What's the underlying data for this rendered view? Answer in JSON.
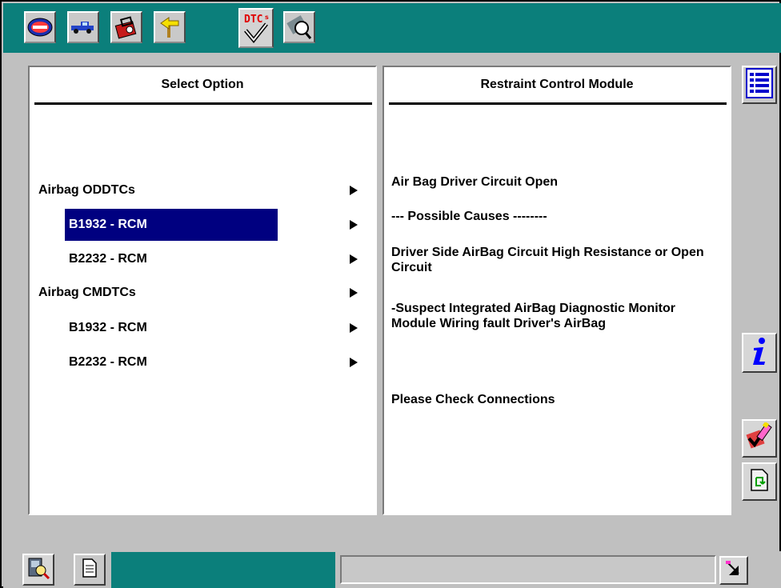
{
  "toolbar": {
    "tabs": [
      {
        "icon": "vehicle-badge-icon"
      },
      {
        "icon": "truck-icon"
      },
      {
        "icon": "toolbox-icon"
      },
      {
        "icon": "arrow-sign-icon"
      },
      {
        "icon": "dtcs-icon",
        "label": "DTCs",
        "active": true
      },
      {
        "icon": "magnifier-icon"
      }
    ]
  },
  "left_panel": {
    "title": "Select Option",
    "options": [
      {
        "label": "Airbag ODDTCs",
        "indent": false,
        "selected": false
      },
      {
        "label": "B1932 - RCM",
        "indent": true,
        "selected": true
      },
      {
        "label": "B2232 - RCM",
        "indent": true,
        "selected": false
      },
      {
        "label": "Airbag CMDTCs",
        "indent": false,
        "selected": false
      },
      {
        "label": "B1932 - RCM",
        "indent": true,
        "selected": false
      },
      {
        "label": "B2232 - RCM",
        "indent": true,
        "selected": false
      }
    ]
  },
  "right_panel": {
    "title": "Restraint Control Module",
    "description": "Air Bag Driver Circuit Open",
    "causes_header": "--- Possible Causes --------",
    "cause_1": "Driver Side AirBag Circuit High Resistance or Open Circuit",
    "cause_2": "-Suspect Integrated AirBag Diagnostic Monitor Module Wiring fault Driver's AirBag",
    "action": "Please Check Connections"
  },
  "side_buttons": {
    "list": "list-icon",
    "info": "info-icon",
    "erase": "erase-dtc-icon",
    "refresh": "refresh-page-icon"
  },
  "bottom": {
    "tabs": [
      "diagnostic-tool-icon",
      "document-icon"
    ],
    "status_text": "",
    "corner": "resize-icon"
  },
  "colors": {
    "teal": "#0b7f7b",
    "selection": "#000080",
    "info_blue": "#0000ff"
  }
}
